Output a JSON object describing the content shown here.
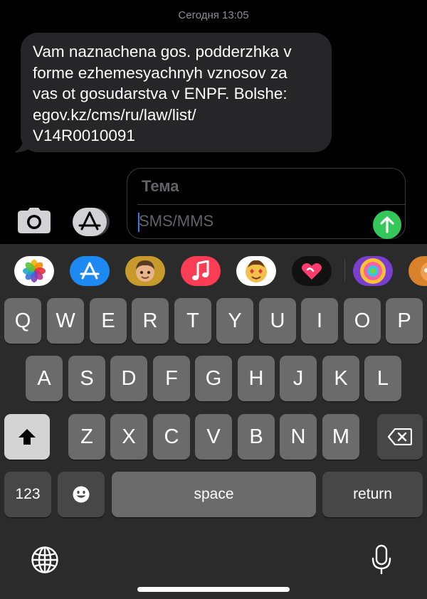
{
  "header": {
    "timestamp": "Сегодня 13:05"
  },
  "message": {
    "text": "Vam naznachena gos. podderzhka v\nforme ezhemesyachnyh vznosov za\nvas ot gosudarstva v ENPF. Bolshe:\negov.kz/cms/ru/law/list/\nV14R0010091"
  },
  "compose": {
    "subject_placeholder": "Тема",
    "message_placeholder": "SMS/MMS",
    "send_color": "#34c759"
  },
  "app_strip": {
    "apps": [
      "photos-app-icon",
      "app-store-app-icon",
      "memoji-app-icon",
      "music-app-icon",
      "animoji-app-icon",
      "digital-touch-app-icon",
      "game-app-icon",
      "animal-game-app-icon"
    ]
  },
  "keyboard": {
    "row1": [
      "Q",
      "W",
      "E",
      "R",
      "T",
      "Y",
      "U",
      "I",
      "O",
      "P"
    ],
    "row2": [
      "A",
      "S",
      "D",
      "F",
      "G",
      "H",
      "J",
      "K",
      "L"
    ],
    "row3": [
      "Z",
      "X",
      "C",
      "V",
      "B",
      "N",
      "M"
    ],
    "numbers_label": "123",
    "space_label": "space",
    "return_label": "return"
  }
}
